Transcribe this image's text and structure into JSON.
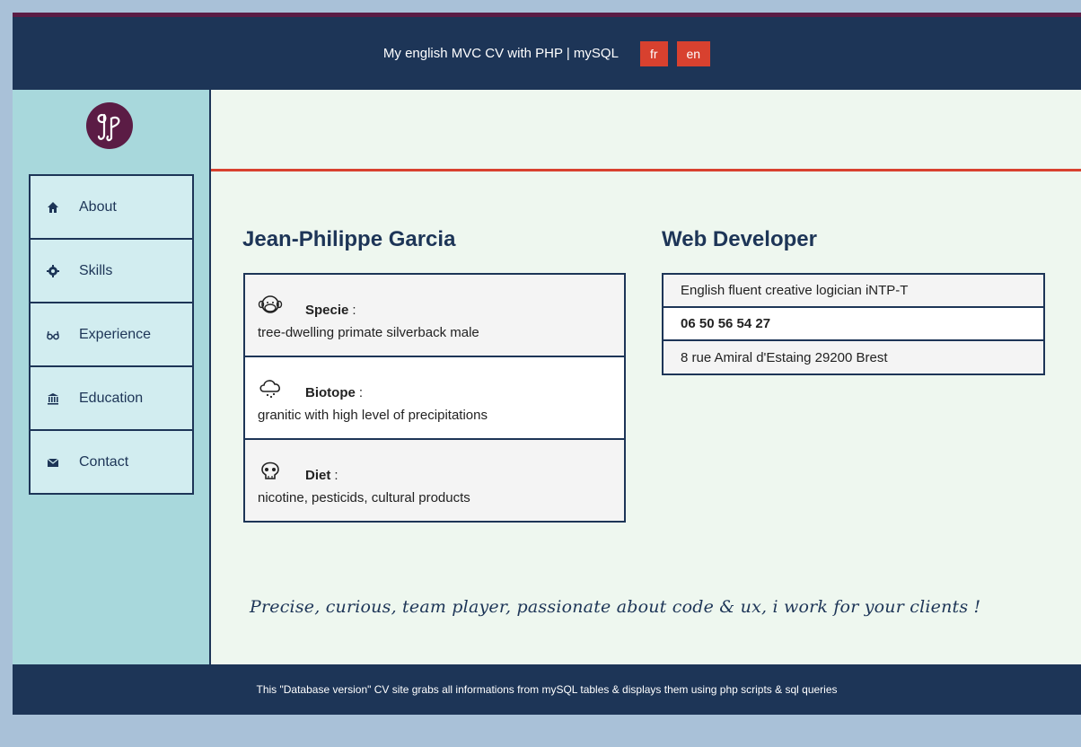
{
  "header": {
    "title": "My english MVC CV with PHP | mySQL",
    "lang_fr": "fr",
    "lang_en": "en"
  },
  "sidebar": {
    "logo_icon": "jp-monogram-logo",
    "items": [
      {
        "label": "About",
        "icon": "house-icon"
      },
      {
        "label": "Skills",
        "icon": "gear-icon"
      },
      {
        "label": "Experience",
        "icon": "glasses-icon"
      },
      {
        "label": "Education",
        "icon": "bank-icon"
      },
      {
        "label": "Contact",
        "icon": "envelope-icon"
      }
    ]
  },
  "main": {
    "name": "Jean-Philippe Garcia",
    "job": "Web Developer",
    "traits": [
      {
        "label": "Specie",
        "colon": ":",
        "value": "tree-dwelling primate silverback male",
        "icon": "monkey-icon"
      },
      {
        "label": "Biotope",
        "colon": ":",
        "value": "granitic with high level of precipitations",
        "icon": "rain-cloud-icon"
      },
      {
        "label": "Diet",
        "colon": ":",
        "value": "nicotine, pesticids, cultural products",
        "icon": "skull-icon"
      }
    ],
    "contact": [
      "English fluent creative logician iNTP-T",
      "06 50 56 54 27",
      "8 rue Amiral d'Estaing 29200 Brest"
    ],
    "tagline": "Precise, curious, team player, passionate about code & ux, i work for your clients !"
  },
  "footer": {
    "text": "This \"Database version\" CV site grabs all informations from mySQL tables & displays them using php scripts & sql queries"
  },
  "colors": {
    "navy": "#1d3557",
    "accent_red": "#d8412f",
    "plum": "#5b1c45",
    "sidebar_teal": "#a8d8dc",
    "content_bg": "#eef7ef"
  }
}
